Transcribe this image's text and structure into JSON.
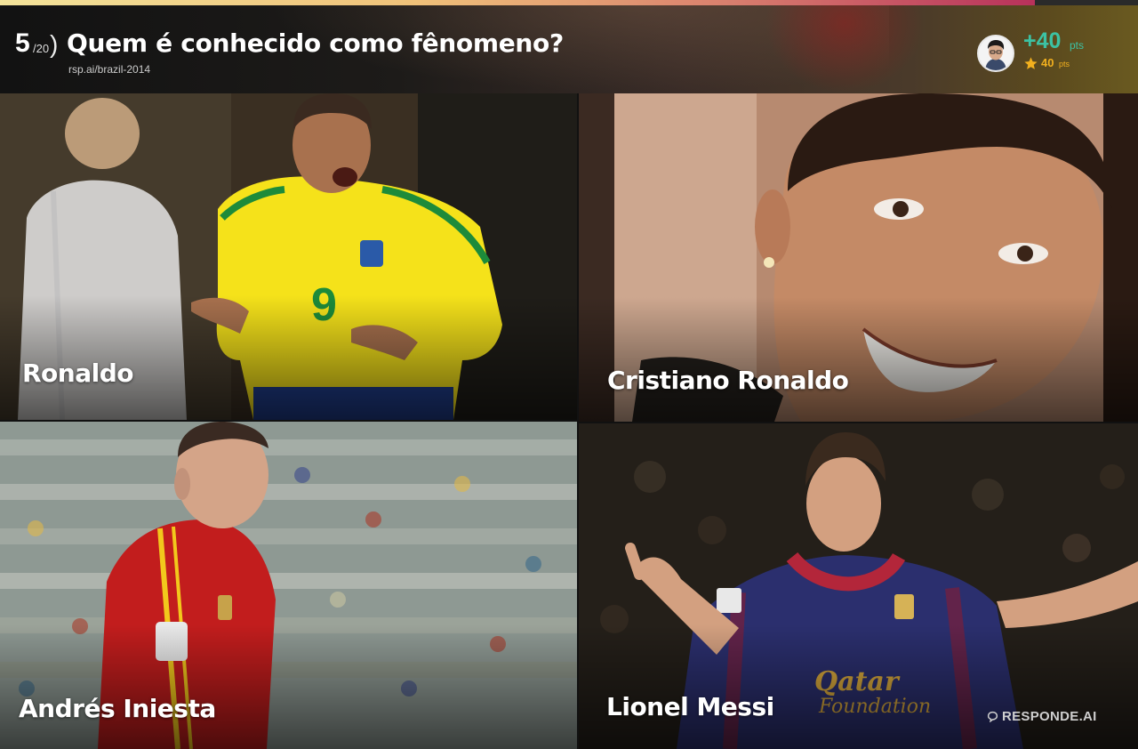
{
  "progress": {
    "fraction": 0.909
  },
  "header": {
    "question_number": "5",
    "question_total": "/20",
    "paren": ")",
    "question_text": "Quem é conhecido como fênomeno?",
    "link": "rsp.ai/brazil-2014",
    "close_glyph": "×",
    "score": {
      "main": "+40",
      "main_unit": "pts",
      "stars": "40",
      "stars_unit": "pts"
    }
  },
  "answers": [
    {
      "label": "Ronaldo"
    },
    {
      "label": "Cristiano Ronaldo"
    },
    {
      "label": "Andrés Iniesta"
    },
    {
      "label": "Lionel Messi"
    }
  ],
  "brand": {
    "text": "RESPONDE.AI"
  },
  "icons": {
    "close": "close-icon",
    "star": "star-icon",
    "brand": "speech-bubble-icon"
  },
  "colors": {
    "score_green": "#3cc2a4",
    "star_gold": "#f2b01e",
    "progress_end": "#b8315b"
  }
}
